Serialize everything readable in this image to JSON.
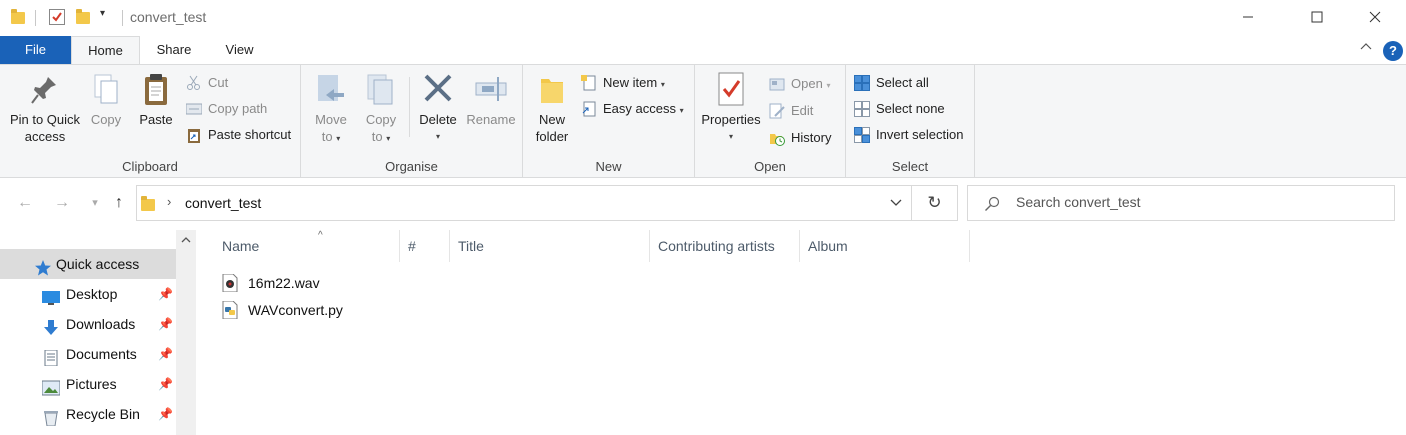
{
  "window": {
    "title": "convert_test",
    "controls": {
      "minimize": "—",
      "maximize": "☐",
      "close": "✕"
    }
  },
  "ribbon_tabs": [
    "File",
    "Home",
    "Share",
    "View"
  ],
  "ribbon": {
    "clipboard": {
      "label": "Clipboard",
      "pin_line1": "Pin to Quick",
      "pin_line2": "access",
      "copy": "Copy",
      "paste": "Paste",
      "cut": "Cut",
      "copy_path": "Copy path",
      "paste_shortcut": "Paste shortcut"
    },
    "organise": {
      "label": "Organise",
      "move_line1": "Move",
      "move_line2": "to",
      "copy_line1": "Copy",
      "copy_line2": "to",
      "delete": "Delete",
      "rename": "Rename"
    },
    "new": {
      "label": "New",
      "folder_line1": "New",
      "folder_line2": "folder",
      "new_item": "New item",
      "easy_access": "Easy access"
    },
    "open": {
      "label": "Open",
      "properties": "Properties",
      "open": "Open",
      "edit": "Edit",
      "history": "History"
    },
    "select": {
      "label": "Select",
      "select_all": "Select all",
      "select_none": "Select none",
      "invert": "Invert selection"
    }
  },
  "address": {
    "path": "convert_test",
    "search_placeholder": "Search convert_test"
  },
  "nav_pane": {
    "items": [
      {
        "label": "Quick access",
        "icon": "star-icon",
        "selected": true,
        "pinned": false
      },
      {
        "label": "Desktop",
        "icon": "desktop-icon",
        "pinned": true
      },
      {
        "label": "Downloads",
        "icon": "download-icon",
        "pinned": true
      },
      {
        "label": "Documents",
        "icon": "documents-icon",
        "pinned": true
      },
      {
        "label": "Pictures",
        "icon": "pictures-icon",
        "pinned": true
      },
      {
        "label": "Recycle Bin",
        "icon": "recycle-bin-icon",
        "pinned": true
      }
    ]
  },
  "file_list": {
    "columns": [
      "Name",
      "#",
      "Title",
      "Contributing artists",
      "Album"
    ],
    "files": [
      {
        "name": "16m22.wav",
        "icon": "audio-file-icon"
      },
      {
        "name": "WAVconvert.py",
        "icon": "python-file-icon"
      }
    ]
  },
  "colors": {
    "accent": "#1a62b8",
    "ribbon_bg": "#f5f6f7",
    "folder": "#f3c84a",
    "selected_nav": "#dcdcdc"
  }
}
